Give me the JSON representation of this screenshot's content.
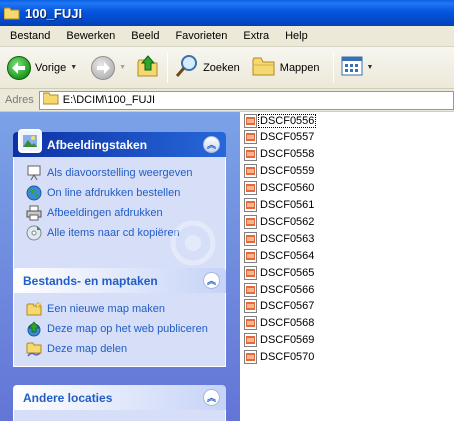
{
  "window": {
    "title": "100_FUJI"
  },
  "menu": [
    "Bestand",
    "Bewerken",
    "Beeld",
    "Favorieten",
    "Extra",
    "Help"
  ],
  "toolbar": {
    "back_label": "Vorige",
    "search_label": "Zoeken",
    "folders_label": "Mappen"
  },
  "address": {
    "label": "Adres",
    "value": "E:\\DCIM\\100_FUJI"
  },
  "taskpane": {
    "picture_tasks": {
      "title": "Afbeeldingstaken",
      "items": [
        "Als diavoorstelling weergeven",
        "On line afdrukken bestellen",
        "Afbeeldingen afdrukken",
        "Alle items naar cd kopiëren"
      ]
    },
    "file_tasks": {
      "title": "Bestands- en maptaken",
      "items": [
        "Een nieuwe map maken",
        "Deze map op het web publiceren",
        "Deze map delen"
      ]
    },
    "other_places": {
      "title": "Andere locaties"
    }
  },
  "files": [
    "DSCF0556",
    "DSCF0557",
    "DSCF0558",
    "DSCF0559",
    "DSCF0560",
    "DSCF0561",
    "DSCF0562",
    "DSCF0563",
    "DSCF0564",
    "DSCF0565",
    "DSCF0566",
    "DSCF0567",
    "DSCF0568",
    "DSCF0569",
    "DSCF0570"
  ],
  "colors": {
    "titlebar": "#0555de",
    "task_link": "#215dc6",
    "pane_bg": "#6375d6"
  }
}
